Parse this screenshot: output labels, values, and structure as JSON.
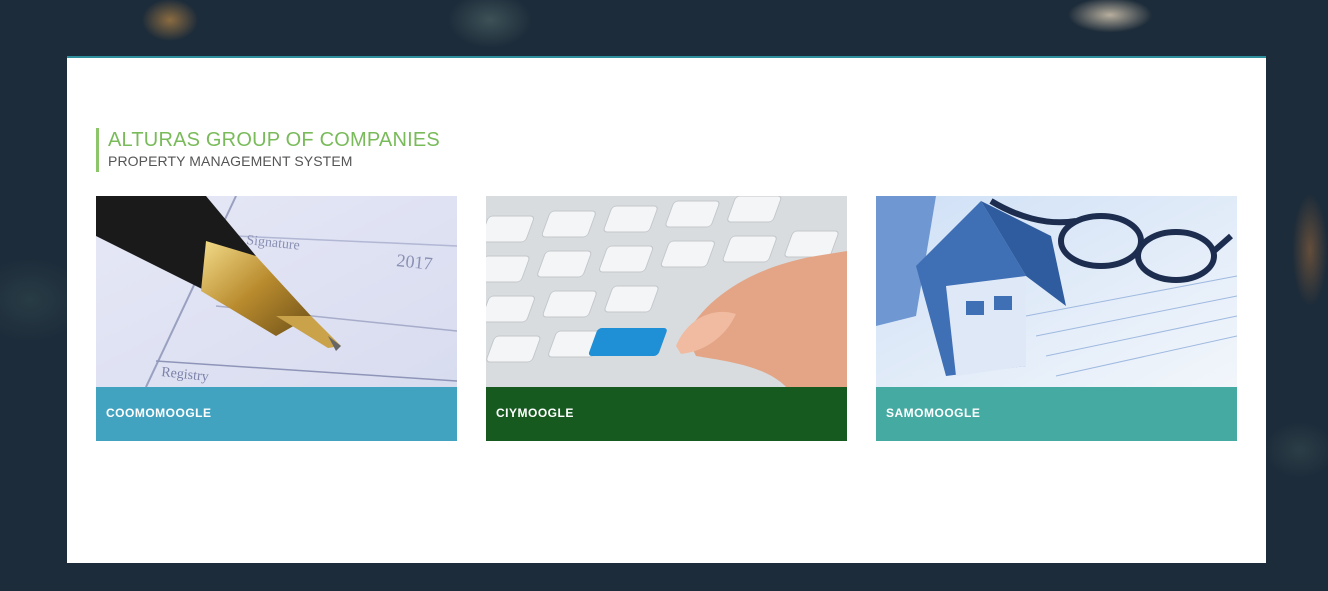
{
  "header": {
    "company": "ALTURAS GROUP OF COMPANIES",
    "system": "PROPERTY MANAGEMENT SYSTEM"
  },
  "cards": [
    {
      "icon": "pen-document-image",
      "label": "COOMOMOOGLE",
      "color": "#42a3c0"
    },
    {
      "icon": "keyboard-image",
      "label": "CIYMOOGLE",
      "color": "#165a20"
    },
    {
      "icon": "house-glasses-image",
      "label": "SAMOMOOGLE",
      "color": "#44aaa2"
    }
  ]
}
